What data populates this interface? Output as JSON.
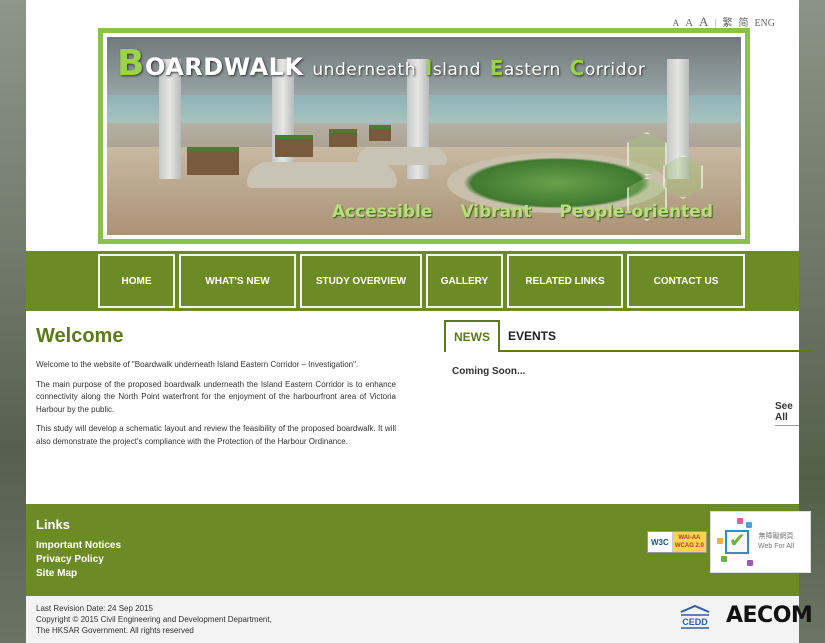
{
  "lang": {
    "font_small": "A",
    "font_medium": "A",
    "font_large": "A",
    "separator": "|",
    "traditional": "繁",
    "simplified": "简",
    "english": "ENG"
  },
  "banner": {
    "title_b": "B",
    "title_rest": "OARDWALK",
    "title_underneath": "underneath",
    "title_i": "I",
    "title_sland": "sland",
    "title_e": "E",
    "title_astern": "astern",
    "title_c": "C",
    "title_orridor": "orridor",
    "tagline": [
      "Accessible",
      "Vibrant",
      "People-oriented"
    ]
  },
  "nav": {
    "items": [
      {
        "label": "HOME"
      },
      {
        "label": "WHAT'S NEW"
      },
      {
        "label": "STUDY OVERVIEW"
      },
      {
        "label": "GALLERY"
      },
      {
        "label": "RELATED LINKS"
      },
      {
        "label": "CONTACT US"
      }
    ]
  },
  "welcome": {
    "title": "Welcome",
    "paragraphs": [
      "Welcome to the website of \"Boardwalk underneath Island Eastern Corridor – Investigation\".",
      "The main purpose of the proposed boardwalk underneath the Island Eastern Corridor is to enhance connectivity along the North Point waterfront for the enjoyment of the harbourfront area of Victoria Harbour by the public.",
      "This study will develop a schematic layout and review the feasibility of the proposed boardwalk. It will also demonstrate the project's compliance with the Protection of the Harbour Ordinance."
    ]
  },
  "news": {
    "tab_news": "NEWS",
    "tab_events": "EVENTS",
    "content": "Coming Soon...",
    "see_all": "See All"
  },
  "links": {
    "title": "Links",
    "items": [
      {
        "label": "Important Notices"
      },
      {
        "label": "Privacy Policy"
      },
      {
        "label": "Site Map"
      }
    ],
    "w3c_label": "W3C",
    "wcag_line1": "WAI-AA",
    "wcag_line2": "WCAG 2.0",
    "wfa_line1": "無障礙網頁",
    "wfa_line2": "Web For All"
  },
  "footer": {
    "revision": "Last Revision Date: 24 Sep 2015",
    "copyright": "Copyright © 2015 Civil Engineering and Development Department,",
    "rights": "The HKSAR Government. All rights reserved",
    "cedd_logo": "CEDD",
    "aecom_logo": "AECOM"
  },
  "colors": {
    "brand_green": "#6d8b24",
    "title_green": "#5c7a1a",
    "banner_border": "#8cc04f"
  }
}
